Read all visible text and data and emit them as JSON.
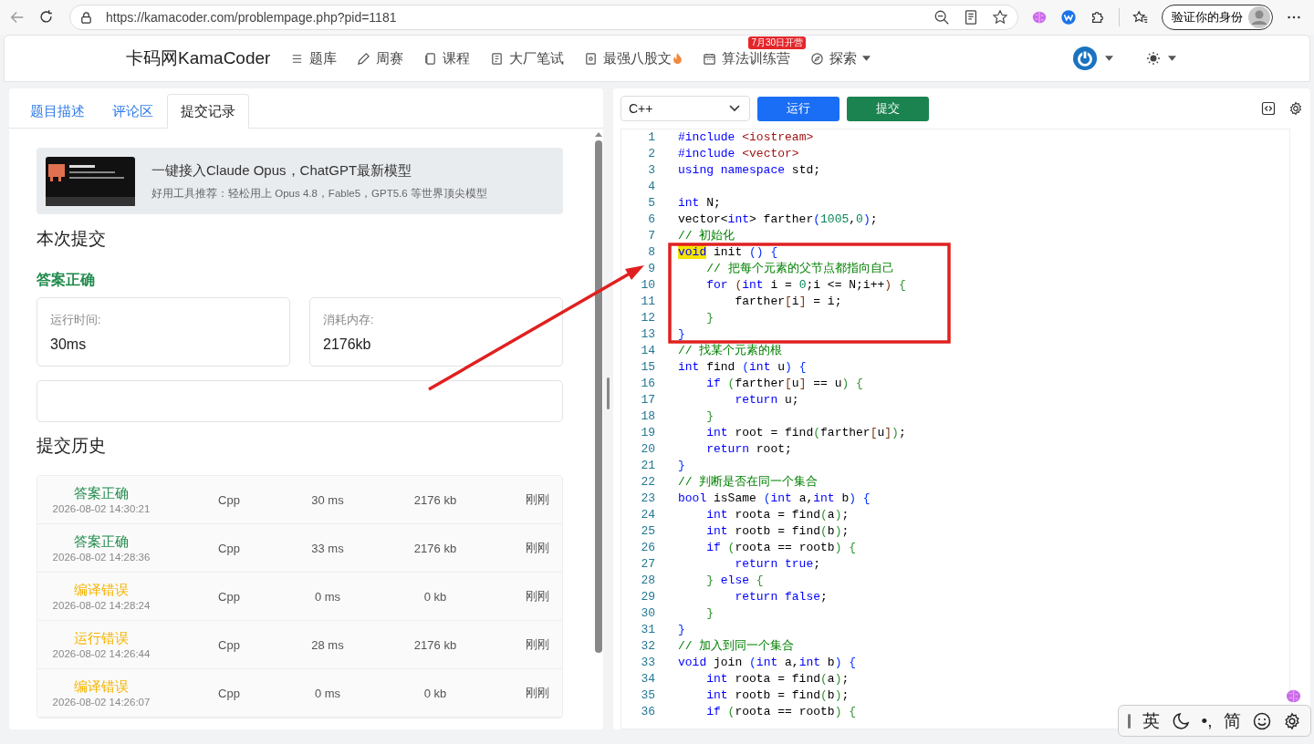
{
  "browser": {
    "url": "https://kamacoder.com/problempage.php?pid=1181",
    "profile_label": "验证你的身份"
  },
  "navbar": {
    "brand": "卡码网KamaCoder",
    "items": [
      {
        "kind": "list",
        "label": "题库",
        "hot": false,
        "dropdown": false
      },
      {
        "kind": "pencil",
        "label": "周赛",
        "hot": false,
        "dropdown": false
      },
      {
        "kind": "copy",
        "label": "课程",
        "hot": false,
        "dropdown": false
      },
      {
        "kind": "note",
        "label": "大厂笔试",
        "hot": false,
        "dropdown": false
      },
      {
        "kind": "eye",
        "label": "最强八股文",
        "hot": true,
        "dropdown": false
      },
      {
        "kind": "calendar",
        "label": "算法训练营",
        "hot": false,
        "dropdown": false,
        "badge": "7月30日开营"
      },
      {
        "kind": "compass",
        "label": "探索",
        "hot": false,
        "dropdown": true
      }
    ]
  },
  "left_panel": {
    "tabs": [
      {
        "label": "题目描述",
        "selected": false
      },
      {
        "label": "评论区",
        "selected": false
      },
      {
        "label": "提交记录",
        "selected": true
      }
    ],
    "promo": {
      "title": "一键接入Claude Opus，ChatGPT最新模型",
      "subtitle": "好用工具推荐：轻松用上 Opus 4.8，Fable5，GPT5.6 等世界顶尖模型"
    },
    "current_heading": "本次提交",
    "verdict": "答案正确",
    "stats": [
      {
        "label": "运行时间:",
        "value": "30ms"
      },
      {
        "label": "消耗内存:",
        "value": "2176kb"
      }
    ],
    "history_heading": "提交历史",
    "history": [
      {
        "status": "答案正确",
        "color": "#1f8a4c",
        "time": "2026-08-02 14:30:21",
        "language": "Cpp",
        "runtime": "30 ms",
        "memory": "2176 kb",
        "when": "刚刚"
      },
      {
        "status": "答案正确",
        "color": "#1f8a4c",
        "time": "2026-08-02 14:28:36",
        "language": "Cpp",
        "runtime": "33 ms",
        "memory": "2176 kb",
        "when": "刚刚"
      },
      {
        "status": "编译错误",
        "color": "#f5b400",
        "time": "2026-08-02 14:28:24",
        "language": "Cpp",
        "runtime": "0 ms",
        "memory": "0 kb",
        "when": "刚刚"
      },
      {
        "status": "运行错误",
        "color": "#f5b400",
        "time": "2026-08-02 14:26:44",
        "language": "Cpp",
        "runtime": "28 ms",
        "memory": "2176 kb",
        "when": "刚刚"
      },
      {
        "status": "编译错误",
        "color": "#f5b400",
        "time": "2026-08-02 14:26:07",
        "language": "Cpp",
        "runtime": "0 ms",
        "memory": "0 kb",
        "when": "刚刚"
      }
    ]
  },
  "editor": {
    "language": "C++",
    "run_label": "运行",
    "submit_label": "提交",
    "lines": [
      {
        "number": "1",
        "tokens": [
          {
            "kind": "pp",
            "text": "#include"
          },
          {
            "kind": "str",
            "text": " <iostream>"
          }
        ]
      },
      {
        "number": "2",
        "tokens": [
          {
            "kind": "pp",
            "text": "#include"
          },
          {
            "kind": "str",
            "text": " <vector>"
          }
        ]
      },
      {
        "number": "3",
        "tokens": [
          {
            "kind": "kw",
            "text": "using namespace"
          },
          {
            "kind": "tx",
            "text": " std;"
          }
        ]
      },
      {
        "number": "4"
      },
      {
        "number": "5",
        "tokens": [
          {
            "kind": "kw",
            "text": "int"
          },
          {
            "kind": "tx",
            "text": " N;"
          }
        ]
      },
      {
        "number": "6",
        "tokens": [
          {
            "kind": "tx",
            "text": "vector<"
          },
          {
            "kind": "kw",
            "text": "int"
          },
          {
            "kind": "tx",
            "text": "> farther"
          },
          {
            "kind": "b1",
            "text": "("
          },
          {
            "kind": "num",
            "text": "1005"
          },
          {
            "kind": "tx",
            "text": ","
          },
          {
            "kind": "num",
            "text": "0"
          },
          {
            "kind": "b1",
            "text": ")"
          },
          {
            "kind": "tx",
            "text": ";"
          }
        ]
      },
      {
        "number": "7",
        "tokens": [
          {
            "kind": "cm",
            "text": "// 初始化"
          }
        ]
      },
      {
        "number": "8",
        "tokens": [
          {
            "kind": "hl",
            "text": "void"
          },
          {
            "kind": "tx",
            "text": " init"
          },
          {
            "kind": "b1",
            "text": " () {"
          }
        ]
      },
      {
        "number": "9",
        "tokens": [
          {
            "kind": "cm",
            "text": "    // 把每个元素的父节点都指向自己"
          }
        ]
      },
      {
        "number": "10",
        "tokens": [
          {
            "kind": "kw",
            "text": "    for"
          },
          {
            "kind": "b3",
            "text": " ("
          },
          {
            "kind": "kw",
            "text": "int"
          },
          {
            "kind": "tx",
            "text": " i = "
          },
          {
            "kind": "num",
            "text": "0"
          },
          {
            "kind": "tx",
            "text": ";i <= N;i++"
          },
          {
            "kind": "b3",
            "text": ")"
          },
          {
            "kind": "b2",
            "text": " {"
          }
        ]
      },
      {
        "number": "11",
        "tokens": [
          {
            "kind": "tx",
            "text": "        farther"
          },
          {
            "kind": "b3",
            "text": "["
          },
          {
            "kind": "tx",
            "text": "i"
          },
          {
            "kind": "b3",
            "text": "]"
          },
          {
            "kind": "tx",
            "text": " = i;"
          }
        ]
      },
      {
        "number": "12",
        "tokens": [
          {
            "kind": "b2",
            "text": "    }"
          }
        ]
      },
      {
        "number": "13",
        "tokens": [
          {
            "kind": "b1",
            "text": "}"
          }
        ]
      },
      {
        "number": "14",
        "tokens": [
          {
            "kind": "cm",
            "text": "// 找某个元素的根"
          }
        ]
      },
      {
        "number": "15",
        "tokens": [
          {
            "kind": "kw",
            "text": "int"
          },
          {
            "kind": "tx",
            "text": " find"
          },
          {
            "kind": "b1",
            "text": " ("
          },
          {
            "kind": "kw",
            "text": "int"
          },
          {
            "kind": "tx",
            "text": " u"
          },
          {
            "kind": "b1",
            "text": ") {"
          }
        ]
      },
      {
        "number": "16",
        "tokens": [
          {
            "kind": "kw",
            "text": "    if"
          },
          {
            "kind": "b2",
            "text": " ("
          },
          {
            "kind": "tx",
            "text": "farther"
          },
          {
            "kind": "b3",
            "text": "["
          },
          {
            "kind": "tx",
            "text": "u"
          },
          {
            "kind": "b3",
            "text": "]"
          },
          {
            "kind": "tx",
            "text": " == u"
          },
          {
            "kind": "b2",
            "text": ") {"
          }
        ]
      },
      {
        "number": "17",
        "tokens": [
          {
            "kind": "kw",
            "text": "        return"
          },
          {
            "kind": "tx",
            "text": " u;"
          }
        ]
      },
      {
        "number": "18",
        "tokens": [
          {
            "kind": "b2",
            "text": "    }"
          }
        ]
      },
      {
        "number": "19",
        "tokens": [
          {
            "kind": "kw",
            "text": "    int"
          },
          {
            "kind": "tx",
            "text": " root = find"
          },
          {
            "kind": "b2",
            "text": "("
          },
          {
            "kind": "tx",
            "text": "farther"
          },
          {
            "kind": "b3",
            "text": "["
          },
          {
            "kind": "tx",
            "text": "u"
          },
          {
            "kind": "b3",
            "text": "]"
          },
          {
            "kind": "b2",
            "text": ")"
          },
          {
            "kind": "tx",
            "text": ";"
          }
        ]
      },
      {
        "number": "20",
        "tokens": [
          {
            "kind": "kw",
            "text": "    return"
          },
          {
            "kind": "tx",
            "text": " root;"
          }
        ]
      },
      {
        "number": "21",
        "tokens": [
          {
            "kind": "b1",
            "text": "}"
          }
        ]
      },
      {
        "number": "22",
        "tokens": [
          {
            "kind": "cm",
            "text": "// 判断是否在同一个集合"
          }
        ]
      },
      {
        "number": "23",
        "tokens": [
          {
            "kind": "kw",
            "text": "bool"
          },
          {
            "kind": "tx",
            "text": " isSame"
          },
          {
            "kind": "b1",
            "text": " ("
          },
          {
            "kind": "kw",
            "text": "int"
          },
          {
            "kind": "tx",
            "text": " a,"
          },
          {
            "kind": "kw",
            "text": "int"
          },
          {
            "kind": "tx",
            "text": " b"
          },
          {
            "kind": "b1",
            "text": ") {"
          }
        ]
      },
      {
        "number": "24",
        "tokens": [
          {
            "kind": "kw",
            "text": "    int"
          },
          {
            "kind": "tx",
            "text": " roota = find"
          },
          {
            "kind": "b2",
            "text": "("
          },
          {
            "kind": "tx",
            "text": "a"
          },
          {
            "kind": "b2",
            "text": ")"
          },
          {
            "kind": "tx",
            "text": ";"
          }
        ]
      },
      {
        "number": "25",
        "tokens": [
          {
            "kind": "kw",
            "text": "    int"
          },
          {
            "kind": "tx",
            "text": " rootb = find"
          },
          {
            "kind": "b2",
            "text": "("
          },
          {
            "kind": "tx",
            "text": "b"
          },
          {
            "kind": "b2",
            "text": ")"
          },
          {
            "kind": "tx",
            "text": ";"
          }
        ]
      },
      {
        "number": "26",
        "tokens": [
          {
            "kind": "kw",
            "text": "    if"
          },
          {
            "kind": "b2",
            "text": " ("
          },
          {
            "kind": "tx",
            "text": "roota == rootb"
          },
          {
            "kind": "b2",
            "text": ") {"
          }
        ]
      },
      {
        "number": "27",
        "tokens": [
          {
            "kind": "kw",
            "text": "        return true"
          },
          {
            "kind": "tx",
            "text": ";"
          }
        ]
      },
      {
        "number": "28",
        "tokens": [
          {
            "kind": "b2",
            "text": "    }"
          },
          {
            "kind": "kw",
            "text": " else"
          },
          {
            "kind": "b2",
            "text": " {"
          }
        ]
      },
      {
        "number": "29",
        "tokens": [
          {
            "kind": "kw",
            "text": "        return false"
          },
          {
            "kind": "tx",
            "text": ";"
          }
        ]
      },
      {
        "number": "30",
        "tokens": [
          {
            "kind": "b2",
            "text": "    }"
          }
        ]
      },
      {
        "number": "31",
        "tokens": [
          {
            "kind": "b1",
            "text": "}"
          }
        ]
      },
      {
        "number": "32",
        "tokens": [
          {
            "kind": "cm",
            "text": "// 加入到同一个集合"
          }
        ]
      },
      {
        "number": "33",
        "tokens": [
          {
            "kind": "kw",
            "text": "void"
          },
          {
            "kind": "tx",
            "text": " join"
          },
          {
            "kind": "b1",
            "text": " ("
          },
          {
            "kind": "kw",
            "text": "int"
          },
          {
            "kind": "tx",
            "text": " a,"
          },
          {
            "kind": "kw",
            "text": "int"
          },
          {
            "kind": "tx",
            "text": " b"
          },
          {
            "kind": "b1",
            "text": ") {"
          }
        ]
      },
      {
        "number": "34",
        "tokens": [
          {
            "kind": "kw",
            "text": "    int"
          },
          {
            "kind": "tx",
            "text": " roota = find"
          },
          {
            "kind": "b2",
            "text": "("
          },
          {
            "kind": "tx",
            "text": "a"
          },
          {
            "kind": "b2",
            "text": ")"
          },
          {
            "kind": "tx",
            "text": ";"
          }
        ]
      },
      {
        "number": "35",
        "tokens": [
          {
            "kind": "kw",
            "text": "    int"
          },
          {
            "kind": "tx",
            "text": " rootb = find"
          },
          {
            "kind": "b2",
            "text": "("
          },
          {
            "kind": "tx",
            "text": "b"
          },
          {
            "kind": "b2",
            "text": ")"
          },
          {
            "kind": "tx",
            "text": ";"
          }
        ]
      },
      {
        "number": "36",
        "tokens": [
          {
            "kind": "kw",
            "text": "    if"
          },
          {
            "kind": "b2",
            "text": " ("
          },
          {
            "kind": "tx",
            "text": "roota == rootb"
          },
          {
            "kind": "b2",
            "text": ") {"
          }
        ]
      }
    ]
  },
  "ime_bar": {
    "items": [
      {
        "kind": "text",
        "text": "英"
      },
      {
        "kind": "moon"
      },
      {
        "kind": "text",
        "text": "•,"
      },
      {
        "kind": "text",
        "text": "简"
      },
      {
        "kind": "smile"
      },
      {
        "kind": "gear"
      }
    ]
  }
}
